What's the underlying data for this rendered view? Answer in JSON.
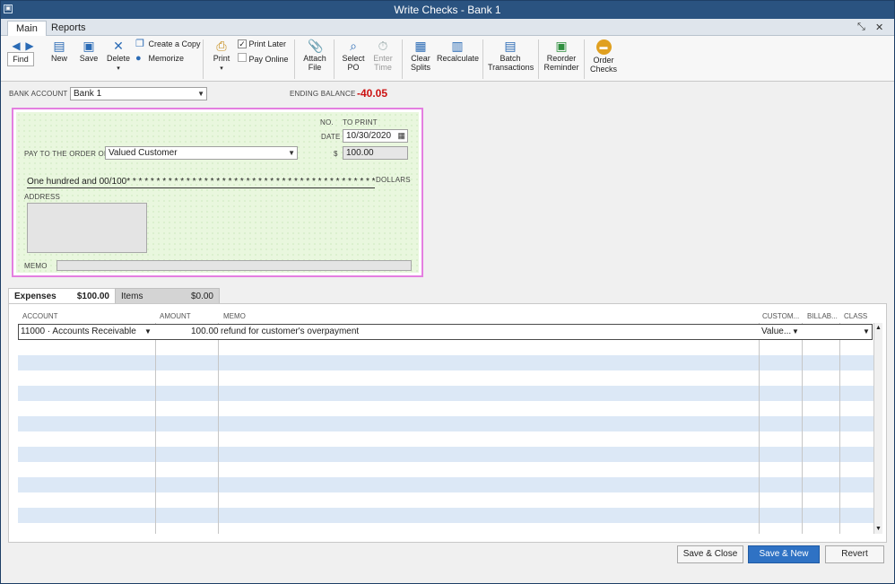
{
  "window": {
    "title": "Write Checks - Bank 1"
  },
  "tabs": [
    {
      "label": "Main"
    },
    {
      "label": "Reports"
    }
  ],
  "toolbar": {
    "find": "Find",
    "new": "New",
    "save": "Save",
    "delete": "Delete",
    "create_copy": "Create a Copy",
    "memorize": "Memorize",
    "print": "Print",
    "print_later": "Print Later",
    "pay_online": "Pay Online",
    "attach": [
      "Attach",
      "File"
    ],
    "select_po": [
      "Select",
      "PO"
    ],
    "enter_time": [
      "Enter",
      "Time"
    ],
    "clear_splits": [
      "Clear",
      "Splits"
    ],
    "recalculate": "Recalculate",
    "batch": [
      "Batch",
      "Transactions"
    ],
    "reorder": [
      "Reorder",
      "Reminder"
    ],
    "order_checks": [
      "Order",
      "Checks"
    ]
  },
  "header": {
    "bank_account_label": "BANK ACCOUNT",
    "bank_account_value": "Bank 1",
    "ending_balance_label": "ENDING BALANCE",
    "ending_balance_value": "-40.05",
    "ending_balance_color": "#cc1111"
  },
  "check": {
    "no_label": "NO.",
    "no_value": "TO PRINT",
    "date_label": "DATE",
    "date_value": "10/30/2020",
    "payee_label": "PAY TO THE ORDER OF",
    "payee_value": "Valued Customer",
    "dollar_sign": "$",
    "amount": "100.00",
    "amount_words": "One hundred and 00/100* * * * * * * * * * * * * * * * * * * * * * * * * * * * * * * * * * * * * * * * * * * * * * * * *",
    "dollars_label": "DOLLARS",
    "address_label": "ADDRESS",
    "memo_label": "MEMO",
    "border_color": "#e47fe0"
  },
  "detail_tabs": {
    "expenses_label": "Expenses",
    "expenses_total": "$100.00",
    "items_label": "Items",
    "items_total": "$0.00"
  },
  "grid": {
    "columns": [
      "ACCOUNT",
      "AMOUNT",
      "MEMO",
      "CUSTOM...",
      "BILLAB...",
      "CLASS"
    ],
    "rows": [
      {
        "account": "11000 · Accounts Receivable",
        "amount": "100.00",
        "memo": "refund for customer's overpayment",
        "customer": "Value..."
      }
    ]
  },
  "footer": {
    "save_close": "Save & Close",
    "save_new": "Save & New",
    "revert": "Revert"
  }
}
